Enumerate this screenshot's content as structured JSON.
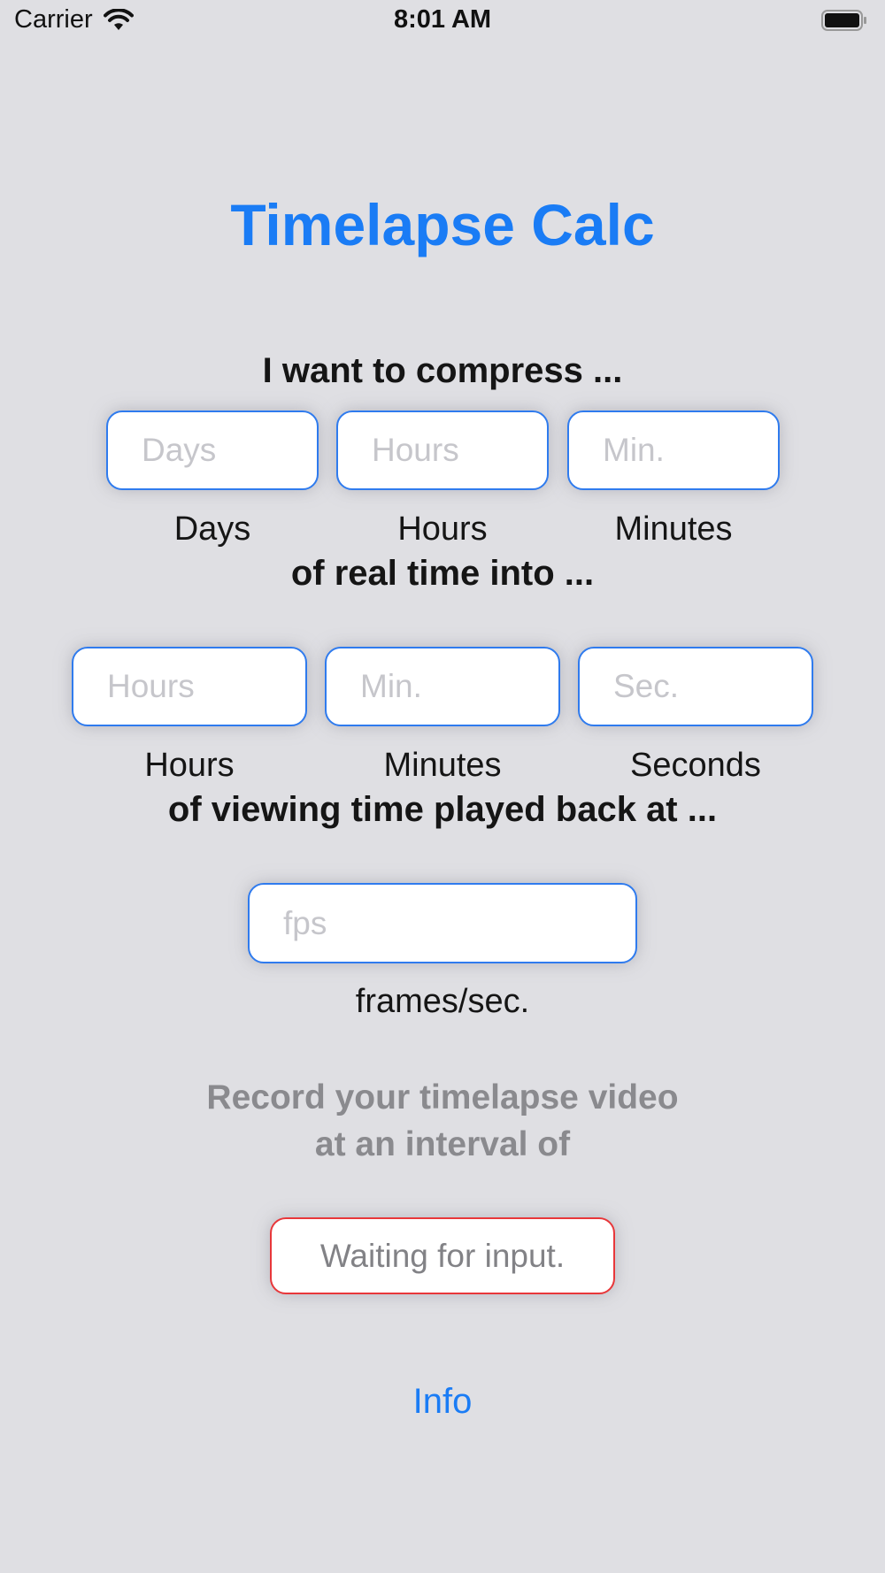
{
  "status_bar": {
    "carrier": "Carrier",
    "time": "8:01 AM"
  },
  "title": "Timelapse Calc",
  "section1": {
    "heading": "I want to compress ...",
    "fields": [
      {
        "placeholder": "Days",
        "unit": "Days"
      },
      {
        "placeholder": "Hours",
        "unit": "Hours"
      },
      {
        "placeholder": "Min.",
        "unit": "Minutes"
      }
    ]
  },
  "section2": {
    "heading": "of real time into ...",
    "fields": [
      {
        "placeholder": "Hours",
        "unit": "Hours"
      },
      {
        "placeholder": "Min.",
        "unit": "Minutes"
      },
      {
        "placeholder": "Sec.",
        "unit": "Seconds"
      }
    ]
  },
  "section3": {
    "heading": "of viewing time played back at ...",
    "fps_placeholder": "fps",
    "fps_unit": "frames/sec."
  },
  "result": {
    "line1": "Record your timelapse video",
    "line2": "at an interval of",
    "value": "Waiting for input."
  },
  "info_label": "Info",
  "colors": {
    "accent": "#1a7cf5",
    "field_border": "#2f7bee",
    "result_border": "#e8373a",
    "background": "#dfdfe3"
  },
  "icons": [
    "wifi-icon",
    "battery-icon"
  ]
}
